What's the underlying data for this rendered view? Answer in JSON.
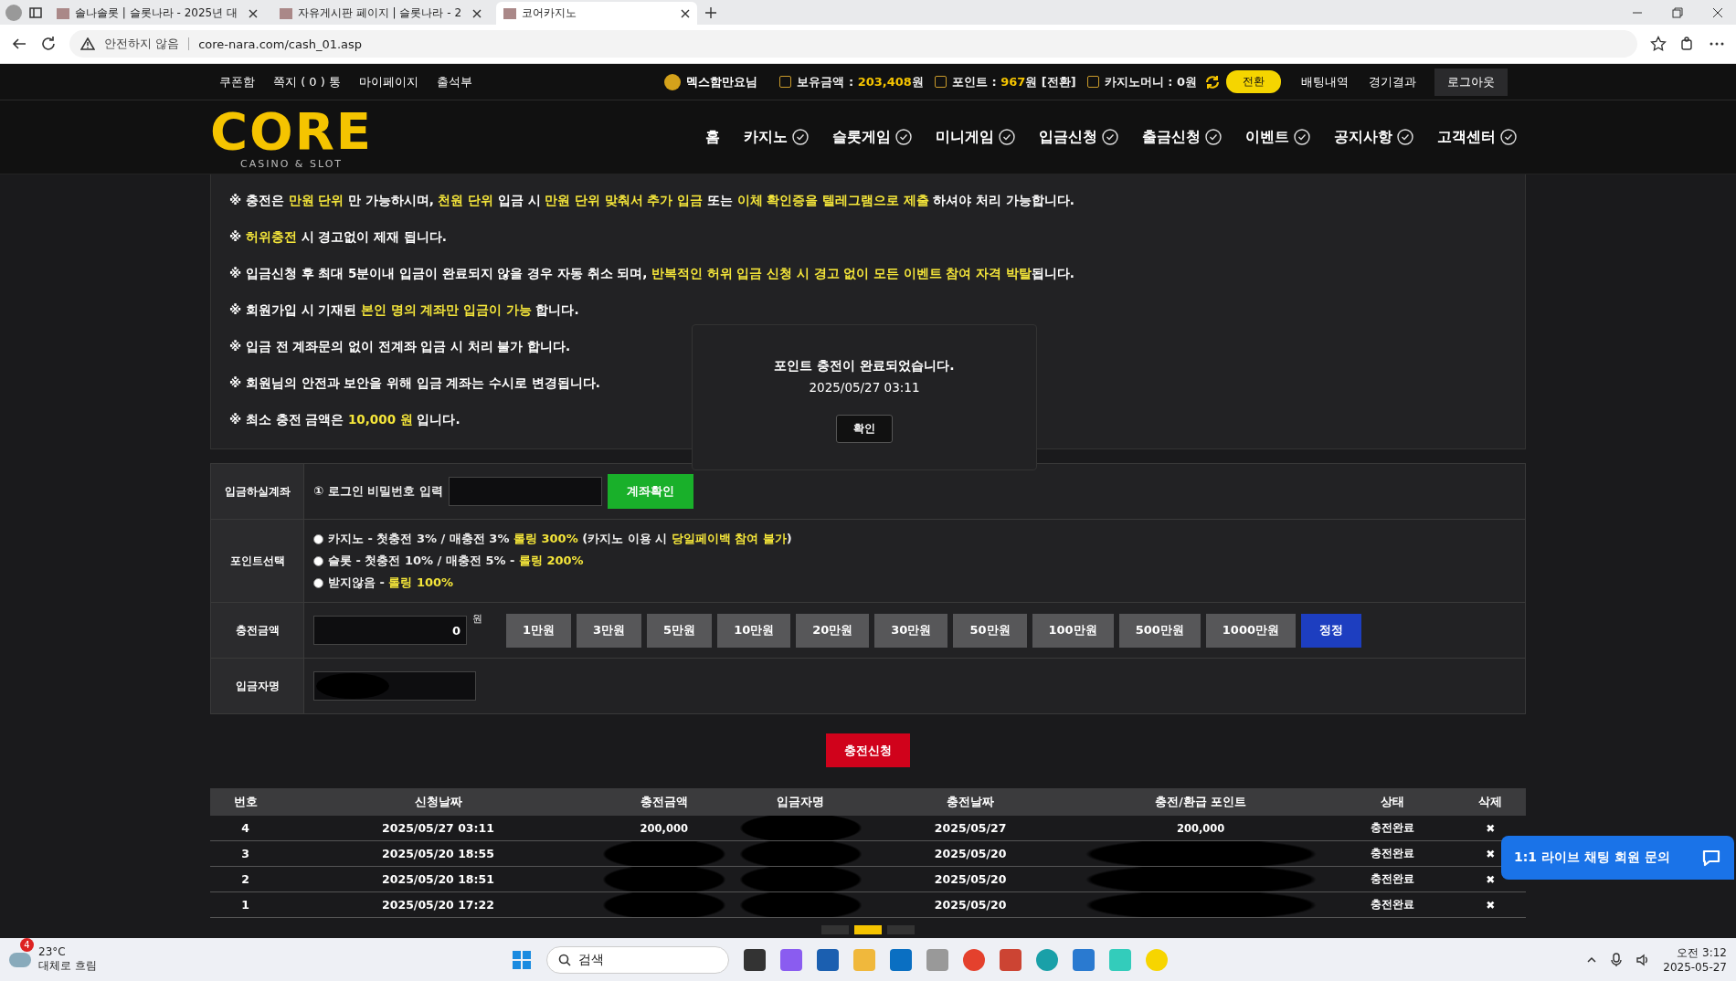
{
  "browser": {
    "tabs": [
      {
        "title": "솔나솔롯 | 슬롯나라 - 2025년 대",
        "selected": false
      },
      {
        "title": "자유게시판 페이지 | 슬롯나라 - 2",
        "selected": false
      },
      {
        "title": "코어카지노",
        "selected": true
      }
    ],
    "url_warning": "안전하지 않음",
    "url": "core-nara.com/cash_01.asp"
  },
  "topbar": {
    "links": [
      "쿠폰함",
      "쪽지 ( 0 ) 통",
      "마이페이지",
      "출석부"
    ],
    "user": "멕스함만요님",
    "balance": "보유금액 : **203,408**원",
    "point": "포인트 : **967**원 [전환]",
    "casino_money": "카지노머니 : 0원",
    "convert_button": "전환",
    "right_links": [
      "배팅내역",
      "경기결과"
    ],
    "logout": "로그아웃"
  },
  "logo": {
    "text": "CORE",
    "sub": "CASINO & SLOT"
  },
  "nav": [
    {
      "label": "홈",
      "chevron": false
    },
    {
      "label": "카지노",
      "chevron": true
    },
    {
      "label": "슬롯게임",
      "chevron": true
    },
    {
      "label": "미니게임",
      "chevron": true
    },
    {
      "label": "입금신청",
      "chevron": true
    },
    {
      "label": "출금신청",
      "chevron": true
    },
    {
      "label": "이벤트",
      "chevron": true
    },
    {
      "label": "공지사항",
      "chevron": true
    },
    {
      "label": "고객센터",
      "chevron": true
    }
  ],
  "notices": [
    "※ 충전은 **만원 단위** 만 가능하시며, **천원 단위** 입금 시 **만원 단위 맞춰서 추가 입금** 또는 **이체 확인증을 텔레그램으로 제출** 하셔야 처리 가능합니다.",
    "※ **허위충전** 시 경고없이 제재 됩니다.",
    "※ 입금신청 후 최대 5분이내 입금이 완료되지 않을 경우 자동 취소 되며, **반복적인 허위 입금 신청 시 경고 없이 모든 이벤트 참여 자격 박탈**됩니다.",
    "※ 회원가입 시 기재된 **본인 명의 계좌만 입금이 가능** 합니다.",
    "※ 입금 전 계좌문의 없이 전계좌 입금 시 처리 불가 합니다.",
    "※ 회원님의 안전과 보안을 위해 입금 계좌는 수시로 변경됩니다.",
    "※ 최소 충전 금액은 **10,000 원** 입니다."
  ],
  "dialog": {
    "message": "포인트 충전이 완료되었습니다.",
    "time": "2025/05/27 03:11",
    "button": "확인"
  },
  "form": {
    "account": {
      "label": "입금하실계좌",
      "hint": "① 로그인 비밀번호 입력",
      "button": "계좌확인"
    },
    "points": {
      "label": "포인트선택",
      "options": [
        {
          "text": "카지노 - 첫충전 3% / 매충전 3% **롤링 300%** (카지노 이용 시 **당일페이백 참여 불가**)",
          "selected": false
        },
        {
          "text": "슬롯 - 첫충전 10% / 매충전 5% - **롤링 200%**",
          "selected": false
        },
        {
          "text": "받지않음 - **롤링 100%**",
          "selected": false
        }
      ]
    },
    "amount": {
      "label": "충전금액",
      "value": "0",
      "unit": "원",
      "quick": [
        "1만원",
        "3만원",
        "5만원",
        "10만원",
        "20만원",
        "30만원",
        "50만원",
        "100만원",
        "500만원",
        "1000만원"
      ],
      "reset": "정정"
    },
    "depositor": {
      "label": "입금자명",
      "redacted": true
    }
  },
  "submit": "충전신청",
  "table": {
    "columns": [
      "번호",
      "신청날짜",
      "충전금액",
      "입금자명",
      "충전날짜",
      "충전/환급 포인트",
      "상태",
      "삭제"
    ],
    "rows": [
      {
        "no": "4",
        "requested": "2025/05/27 03:11",
        "amount": "200,000",
        "charged": "2025/05/27",
        "points": "200,000",
        "status": "충전완료",
        "delete": "✖"
      },
      {
        "no": "3",
        "requested": "2025/05/20 18:55",
        "charged": "2025/05/20",
        "status": "충전완료",
        "delete": "✖"
      },
      {
        "no": "2",
        "requested": "2025/05/20 18:51",
        "charged": "2025/05/20",
        "status": "충전완료",
        "delete": "✖"
      },
      {
        "no": "1",
        "requested": "2025/05/20 17:22",
        "charged": "2025/05/20",
        "status": "충전완료",
        "delete": "✖"
      }
    ]
  },
  "pagination": [
    {
      "selected": false
    },
    {
      "selected": true
    },
    {
      "selected": false
    }
  ],
  "chat": "1:1 라이브 채팅 회원 문의",
  "taskbar": {
    "weather_badge": "4",
    "temperature": "23°C",
    "condition": "대체로 흐림",
    "search": "검색",
    "time": "오전 3:12",
    "date": "2025-05-27"
  }
}
